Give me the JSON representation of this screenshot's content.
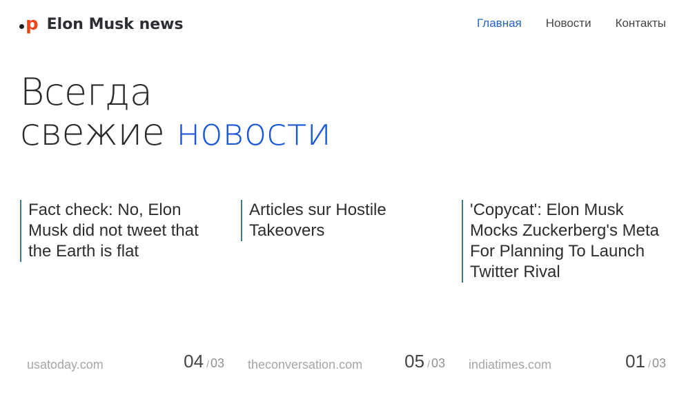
{
  "brand": {
    "logo_letter": "p",
    "name": "Elon Musk news",
    "accent_color": "#f0441c"
  },
  "nav": {
    "items": [
      {
        "label": "Главная",
        "active": true
      },
      {
        "label": "Новости",
        "active": false
      },
      {
        "label": "Контакты",
        "active": false
      }
    ],
    "active_color": "#2563c9"
  },
  "hero": {
    "line1": "Всегда",
    "line2_plain": "свежие",
    "line2_accent": "новости",
    "accent_color": "#1b57d6"
  },
  "news": [
    {
      "title": "Fact check: No, Elon Musk did not tweet that the Earth is flat",
      "source": "usatoday.com",
      "current": "04",
      "total": "03"
    },
    {
      "title": "Articles sur Hostile Takeovers",
      "source": "theconversation.com",
      "current": "05",
      "total": "03"
    },
    {
      "title": "'Copycat': Elon Musk Mocks Zuckerberg's Meta For Planning To Launch Twitter Rival",
      "source": "indiatimes.com",
      "current": "01",
      "total": "03"
    }
  ],
  "counter_separator": "/"
}
